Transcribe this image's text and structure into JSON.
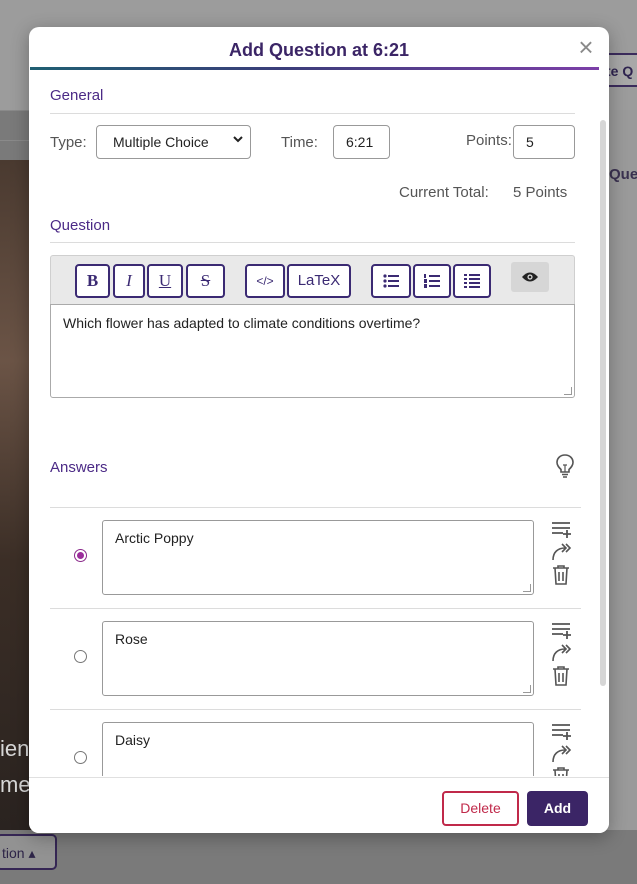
{
  "background": {
    "right_button_label": "te Q",
    "right_tab_label": "Que",
    "text_line1": "ien",
    "text_line2": "me",
    "bottom_button_label": "tion ▴"
  },
  "modal": {
    "title": "Add Question at 6:21",
    "close_icon": "close-icon",
    "general": {
      "section_title": "General",
      "type_label": "Type:",
      "type_value": "Multiple Choice",
      "time_label": "Time:",
      "time_value": "6:21",
      "points_label": "Points:",
      "points_value": "5",
      "current_total_label": "Current Total:",
      "current_total_value": "5 Points"
    },
    "question": {
      "section_title": "Question",
      "toolbar": {
        "bold": "B",
        "italic": "I",
        "underline": "U",
        "strike": "S",
        "code": "</>",
        "latex": "LaTeX",
        "preview_icon": "eye-icon"
      },
      "text": "Which flower has adapted to climate conditions overtime?"
    },
    "answers": {
      "section_title": "Answers",
      "hint_icon": "lightbulb-icon",
      "items": [
        {
          "text": "Arctic Poppy",
          "correct": true
        },
        {
          "text": "Rose",
          "correct": false
        },
        {
          "text": "Daisy",
          "correct": false
        }
      ]
    },
    "footer": {
      "delete_label": "Delete",
      "add_label": "Add"
    }
  },
  "colors": {
    "primary": "#3b2566",
    "accent_purple": "#4b2a86",
    "danger": "#c0294a",
    "radio_selected": "#9b2c9b"
  }
}
